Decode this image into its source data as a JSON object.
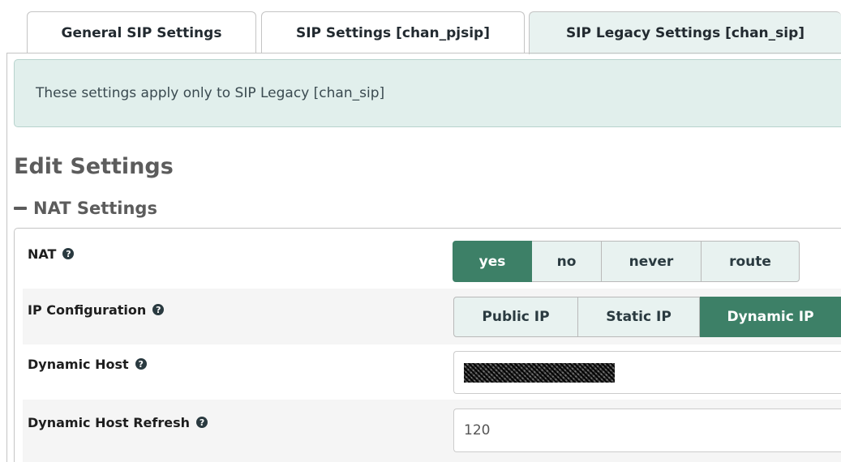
{
  "tabs": [
    {
      "label": "General SIP Settings",
      "active": false
    },
    {
      "label": "SIP Settings [chan_pjsip]",
      "active": false
    },
    {
      "label": "SIP Legacy Settings [chan_sip]",
      "active": true
    }
  ],
  "alert": {
    "text": "These settings apply only to SIP Legacy [chan_sip]"
  },
  "edit_title": "Edit Settings",
  "section": {
    "title": "NAT Settings",
    "collapse_icon": "minus-icon"
  },
  "help_icon_glyph": "?",
  "fields": {
    "nat": {
      "label": "NAT",
      "options": [
        "yes",
        "no",
        "never",
        "route"
      ],
      "selected": "yes"
    },
    "ip_configuration": {
      "label": "IP Configuration",
      "options": [
        "Public IP",
        "Static IP",
        "Dynamic IP"
      ],
      "selected": "Dynamic IP"
    },
    "dynamic_host": {
      "label": "Dynamic Host",
      "value_redacted": true
    },
    "dynamic_host_refresh": {
      "label": "Dynamic Host Refresh",
      "value": "120"
    }
  },
  "colors": {
    "accent": "#3d8067",
    "alert_bg": "#e1efec",
    "active_tab_bg": "#e8f2f0"
  }
}
